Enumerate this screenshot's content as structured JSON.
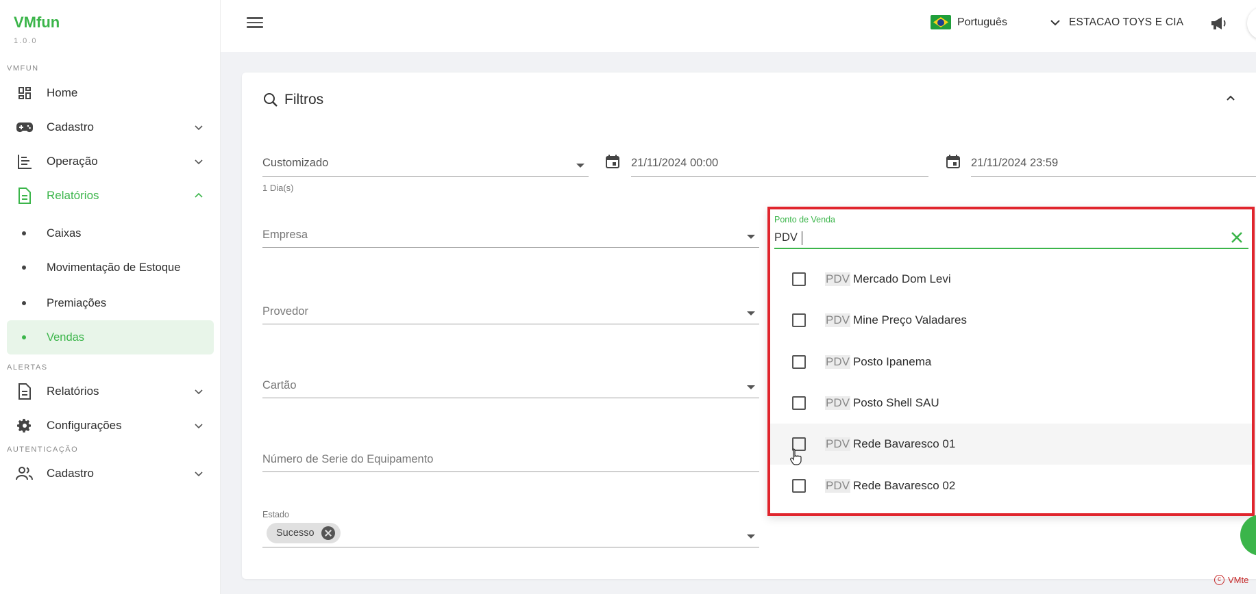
{
  "app": {
    "name": "VMfun",
    "version": "1.0.0"
  },
  "sidebar": {
    "sections": [
      "VMFUN",
      "ALERTAS",
      "AUTENTICAÇÃO"
    ],
    "items": [
      {
        "label": "Home"
      },
      {
        "label": "Cadastro"
      },
      {
        "label": "Operação"
      },
      {
        "label": "Relatórios"
      },
      {
        "label": "Caixas"
      },
      {
        "label": "Movimentação de Estoque"
      },
      {
        "label": "Premiações"
      },
      {
        "label": "Vendas"
      },
      {
        "label": "Relatórios"
      },
      {
        "label": "Configurações"
      },
      {
        "label": "Cadastro"
      }
    ]
  },
  "topbar": {
    "language": "Português",
    "company": "ESTACAO TOYS E CIA"
  },
  "filters": {
    "title": "Filtros",
    "period": {
      "value": "Customizado",
      "hint": "1 Dia(s)"
    },
    "start_date": "21/11/2024 00:00",
    "end_date": "21/11/2024 23:59",
    "empresa_placeholder": "Empresa",
    "provedor_placeholder": "Provedor",
    "cartao_placeholder": "Cartão",
    "serial_placeholder": "Número de Serie do Equipamento",
    "estado": {
      "label": "Estado",
      "chip": "Sucesso"
    }
  },
  "pdv": {
    "label": "Ponto de Venda",
    "query": "PDV",
    "options": [
      {
        "prefix": "PDV",
        "name": "Mercado Dom Levi"
      },
      {
        "prefix": "PDV",
        "name": "Mine Preço Valadares"
      },
      {
        "prefix": "PDV",
        "name": "Posto Ipanema"
      },
      {
        "prefix": "PDV",
        "name": "Posto Shell SAU"
      },
      {
        "prefix": "PDV",
        "name": "Rede Bavaresco 01"
      },
      {
        "prefix": "PDV",
        "name": "Rede Bavaresco 02"
      }
    ]
  },
  "footer": {
    "copyright": "VMte"
  },
  "colors": {
    "accent": "#3bb54a",
    "highlight_border": "#e0252d"
  }
}
